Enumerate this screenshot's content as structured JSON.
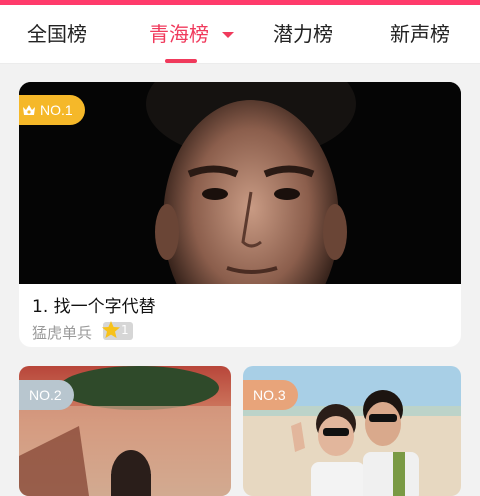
{
  "tabs": [
    {
      "label": "全国榜",
      "active": false
    },
    {
      "label": "青海榜",
      "active": true
    },
    {
      "label": "潜力榜",
      "active": false
    },
    {
      "label": "新声榜",
      "active": false
    }
  ],
  "colors": {
    "accent": "#f03a5c",
    "gold": "#f5b829",
    "silver": "#b8c6cf",
    "bronze": "#e8a47a"
  },
  "icons": {
    "dropdown": "chevron-down-icon",
    "crown": "crown-icon",
    "star": "star-icon"
  },
  "ranking": [
    {
      "badge": "NO.1",
      "title": "1. 找一个字代替",
      "author": "猛虎单兵",
      "level": "1"
    },
    {
      "badge": "NO.2"
    },
    {
      "badge": "NO.3"
    }
  ]
}
